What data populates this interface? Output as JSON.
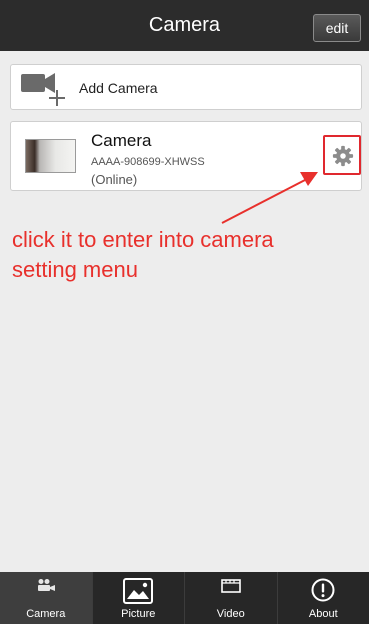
{
  "header": {
    "title": "Camera",
    "edit_label": "edit"
  },
  "add_camera": {
    "label": "Add Camera"
  },
  "camera": {
    "name": "Camera",
    "id": "AAAA-908699-XHWSS",
    "status": "(Online)"
  },
  "annotation": {
    "line1": "click it to enter into camera",
    "line2": "setting menu",
    "color": "#e8302c"
  },
  "tabs": [
    {
      "label": "Camera",
      "icon": "camera-people-icon",
      "active": true
    },
    {
      "label": "Picture",
      "icon": "picture-icon",
      "active": false
    },
    {
      "label": "Video",
      "icon": "video-icon",
      "active": false
    },
    {
      "label": "About",
      "icon": "info-icon",
      "active": false
    }
  ]
}
